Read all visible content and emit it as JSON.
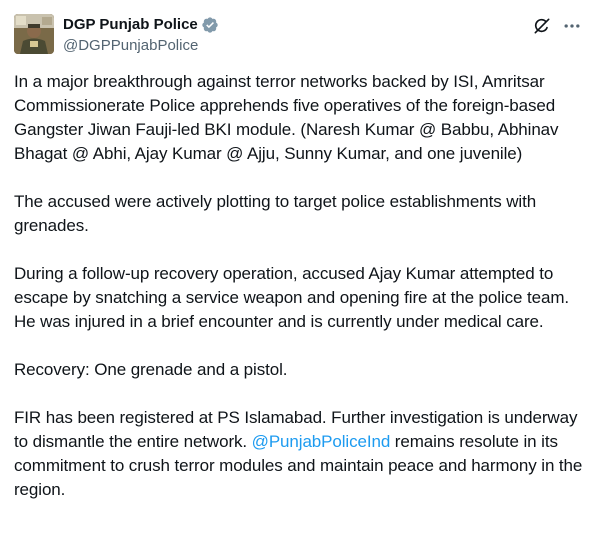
{
  "author": {
    "display_name": "DGP Punjab Police",
    "handle": "@DGPPunjabPolice"
  },
  "icons": {
    "verified": "verified-badge-icon",
    "grok": "grok-icon",
    "more": "more-icon"
  },
  "colors": {
    "text": "#0f1419",
    "secondary": "#536471",
    "link": "#1d9bf0",
    "verified_badge": "#829aab"
  },
  "paragraphs": {
    "p1": "In a major breakthrough against terror networks backed by ISI, Amritsar Commissionerate Police apprehends five operatives of the foreign-based Gangster Jiwan Fauji-led BKI module. (Naresh Kumar @ Babbu, Abhinav Bhagat @ Abhi, Ajay Kumar @ Ajju, Sunny Kumar, and one juvenile)",
    "p2": "The accused were actively plotting to target police establishments with grenades.",
    "p3": "During a follow-up recovery operation, accused Ajay Kumar attempted to escape by snatching a service weapon and opening fire at the police team. He was injured in a brief encounter and is currently under medical care.",
    "p4": "Recovery: One grenade and a pistol.",
    "p5_before": "FIR has been registered at PS Islamabad. Further investigation is underway to dismantle the entire network. ",
    "p5_mention": "@PunjabPoliceInd",
    "p5_after": " remains resolute in its commitment to crush terror modules and maintain peace and harmony in the region."
  }
}
